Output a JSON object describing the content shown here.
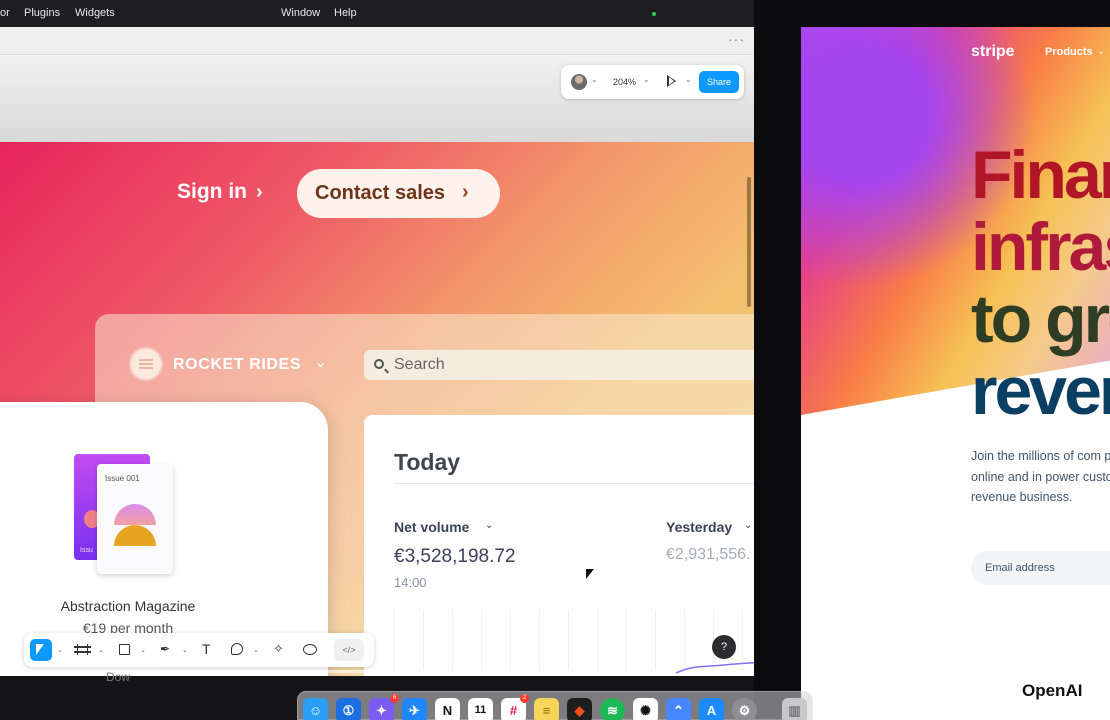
{
  "menubar": {
    "partial_item": "or",
    "items": [
      "Plugins",
      "Widgets",
      "Window",
      "Help"
    ]
  },
  "figma": {
    "more_icon": "more-horizontal-icon",
    "toolbar_top": {
      "zoom": "204%",
      "share_label": "Share"
    },
    "canvas": {
      "signin_label": "Sign in",
      "contact_label": "Contact sales",
      "brand_name": "ROCKET RIDES",
      "search_placeholder": "Search",
      "product": {
        "issue_label": "Issue 001",
        "cover_tag": "Issu",
        "title": "Abstraction Magazine",
        "price": "€19 per month"
      },
      "today": {
        "title": "Today",
        "net_volume_label": "Net volume",
        "net_volume_value": "€3,528,198.72",
        "net_volume_time": "14:00",
        "yesterday_label": "Yesterday",
        "yesterday_value": "€2,931,556."
      }
    },
    "help_label": "?",
    "code_label": "</>",
    "below_text": "Dow"
  },
  "stripe": {
    "logo": "stripe",
    "nav_products": "Products",
    "headline": [
      "Finar",
      "infras",
      "to gro",
      "rever"
    ],
    "subtext": "Join the millions of com payments online and in power custom revenue business.",
    "email_placeholder": "Email address",
    "customer_logo": "OpenAI"
  },
  "dock": {
    "apps": [
      {
        "name": "finder-app-icon",
        "glyph": "☺",
        "color": "#2a9df4"
      },
      {
        "name": "1password-app-icon",
        "glyph": "①",
        "color": "#1c6fe0"
      },
      {
        "name": "launchpad-app-icon",
        "glyph": "✦",
        "color": "#7a5cf0"
      },
      {
        "name": "testflight-app-icon",
        "glyph": "✈",
        "color": "#1f86ff"
      },
      {
        "name": "notion-app-icon",
        "glyph": "N",
        "color": "#ffffff"
      },
      {
        "name": "calendar-app-icon",
        "glyph": "11",
        "color": "#ffffff"
      },
      {
        "name": "slack-app-icon",
        "glyph": "#",
        "color": "#ffffff"
      },
      {
        "name": "notes-app-icon",
        "glyph": "≡",
        "color": "#f7d55a"
      },
      {
        "name": "figma-app-icon",
        "glyph": "◆",
        "color": "#1e1e1e"
      },
      {
        "name": "spotify-app-icon",
        "glyph": "≋",
        "color": "#1db954"
      },
      {
        "name": "chatgpt-app-icon",
        "glyph": "✺",
        "color": "#ffffff"
      },
      {
        "name": "nordvpn-app-icon",
        "glyph": "⌃",
        "color": "#4687ff"
      },
      {
        "name": "app-store-icon",
        "glyph": "A",
        "color": "#1a8cff"
      },
      {
        "name": "system-settings-icon",
        "glyph": "⚙",
        "color": "#8e8e93"
      },
      {
        "name": "trash-icon",
        "glyph": "▥",
        "color": "#c7c7cc"
      }
    ],
    "badges": {
      "launchpad": "6",
      "slack": "2"
    }
  }
}
